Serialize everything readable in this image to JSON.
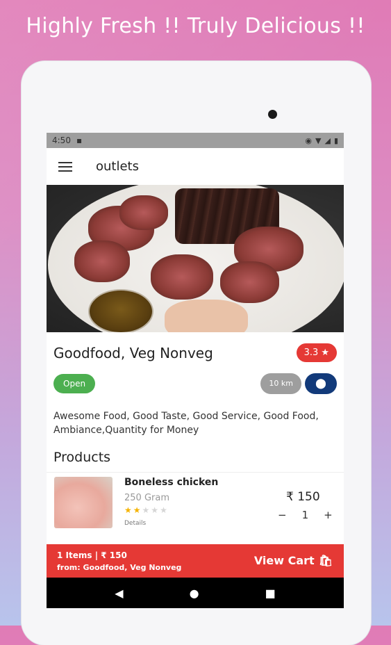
{
  "headline": "Highly Fresh !!  Truly Delicious !!",
  "status_bar": {
    "time": "4:50",
    "icons": [
      "sim-icon",
      "eye-icon",
      "wifi-icon",
      "signal-icon",
      "battery-icon"
    ]
  },
  "app_bar": {
    "title": "outlets",
    "menu_icon": "hamburger-menu-icon"
  },
  "outlet": {
    "name": "Goodfood, Veg Nonveg",
    "rating": "3.3",
    "rating_icon": "star-icon",
    "status": "Open",
    "distance": "10 km",
    "location_icon": "map-pin-icon",
    "description": "Awesome Food, Good Taste, Good Service, Good Food, Ambiance,Quantity for Money"
  },
  "products_section": {
    "title": "Products",
    "items": [
      {
        "name": "Boneless chicken",
        "weight": "250 Gram",
        "rating": 2,
        "rating_max": 5,
        "details_label": "Details",
        "price": "₹ 150",
        "quantity": "1",
        "minus_label": "−",
        "plus_label": "+"
      }
    ]
  },
  "cart": {
    "summary": "1 Items | ₹ 150",
    "from": "from: Goodfood, Veg Nonveg",
    "button_label": "View Cart",
    "button_icon": "shopping-bag-icon"
  },
  "nav_bar": {
    "back_icon": "back-triangle-icon",
    "home_icon": "home-circle-icon",
    "recents_icon": "recents-square-icon"
  },
  "colors": {
    "accent_red": "#e53935",
    "open_green": "#4caf50",
    "location_blue": "#123a7a",
    "distance_grey": "#9e9e9e",
    "star_gold": "#f5b301"
  }
}
